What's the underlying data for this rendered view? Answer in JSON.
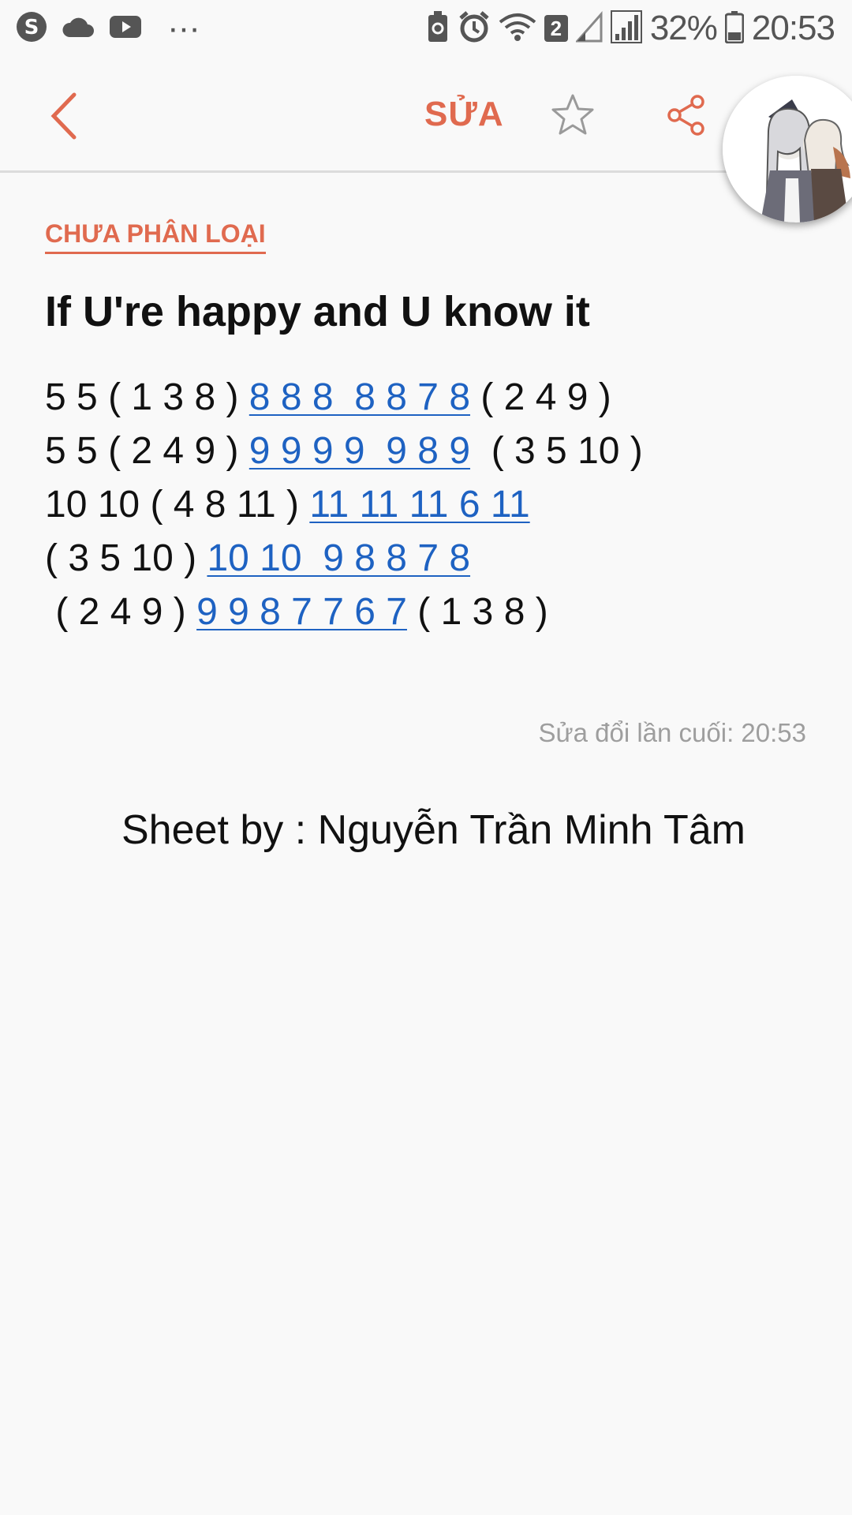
{
  "status_bar": {
    "battery_percent": "32%",
    "time": "20:53",
    "sim_badge": "2",
    "more": "···",
    "left_icons": [
      "notification-s-icon",
      "cloud-icon",
      "youtube-icon"
    ],
    "right_icons": [
      "battery-saver-icon",
      "alarm-icon",
      "wifi-icon",
      "signal-icon",
      "signal-icon",
      "battery-icon"
    ]
  },
  "app_bar": {
    "edit_label": "SỬA",
    "icons": [
      "back-chevron-icon",
      "star-icon",
      "share-icon"
    ],
    "accent": "#e06a4f"
  },
  "note": {
    "category": "CHƯA PHÂN LOẠI",
    "title": "If U're happy and U know it",
    "lines": [
      {
        "pre": "5 5 ( 1 3 8 ) ",
        "link": "8 8 8  8 8 7 8",
        "post": " ( 2 4 9 )"
      },
      {
        "pre": "5 5 ( 2 4 9 ) ",
        "link": "9 9 9 9  9 8 9",
        "post": "  ( 3 5 10 )"
      },
      {
        "pre": "10 10 ( 4 8 11 ) ",
        "link": "11 11 11 6 11",
        "post": ""
      },
      {
        "pre": "( 3 5 10 ) ",
        "link": "10 10  9 8 8 7 8",
        "post": ""
      },
      {
        "pre": " ( 2 4 9 ) ",
        "link": "9 9 8 7 7 6 7",
        "post": " ( 1 3 8 )"
      }
    ],
    "link_color": "#1e62c2",
    "modified": "Sửa đổi lần cuối: 20:53",
    "credit": "Sheet by : Nguyễn Trần Minh Tâm"
  }
}
